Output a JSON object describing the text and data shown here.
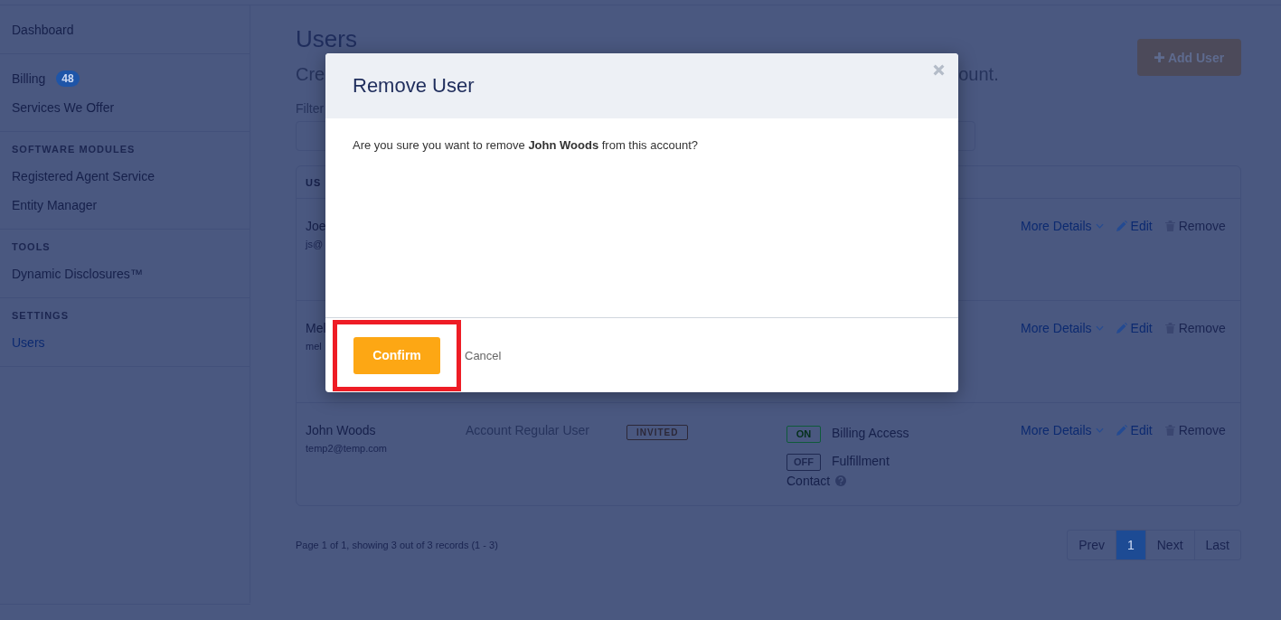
{
  "sidebar": {
    "sections": [
      {
        "items": [
          {
            "label": "Dashboard",
            "selected": false
          }
        ]
      },
      {
        "items": [
          {
            "label": "Billing",
            "badge": "48",
            "selected": false
          },
          {
            "label": "Services We Offer",
            "selected": false
          }
        ]
      },
      {
        "heading": "SOFTWARE MODULES",
        "items": [
          {
            "label": "Registered Agent Service",
            "selected": false
          },
          {
            "label": "Entity Manager",
            "selected": false
          }
        ]
      },
      {
        "heading": "TOOLS",
        "items": [
          {
            "label": "Dynamic Disclosures™",
            "selected": false
          }
        ]
      },
      {
        "heading": "SETTINGS",
        "items": [
          {
            "label": "Users",
            "selected": true
          }
        ]
      }
    ]
  },
  "page": {
    "title": "Users",
    "subtitle_left": "Cre",
    "subtitle_right": "ount.",
    "filter_label": "Filter",
    "add_button": "Add User"
  },
  "table": {
    "header": "US",
    "rows": [
      {
        "name": "Joe",
        "email": "js@",
        "actions": [
          "More Details",
          "Edit",
          "Remove"
        ]
      },
      {
        "name": "Mel",
        "email": "mel",
        "actions": [
          "More Details",
          "Edit",
          "Remove"
        ]
      },
      {
        "name": "John Woods",
        "email": "temp2@temp.com",
        "role": "Account Regular User",
        "status": "INVITED",
        "permissions": [
          {
            "toggle": "ON",
            "on": true,
            "label": "Billing Access",
            "help": false
          },
          {
            "toggle": "OFF",
            "on": false,
            "label": "Fulfillment Contact",
            "help": true
          }
        ],
        "actions": [
          "More Details",
          "Edit",
          "Remove"
        ]
      }
    ]
  },
  "footer": {
    "summary": "Page 1 of 1, showing 3 out of 3 records (1 - 3)",
    "pages": [
      {
        "label": "Prev",
        "selected": false
      },
      {
        "label": "1",
        "selected": true
      },
      {
        "label": "Next",
        "selected": false
      },
      {
        "label": "Last",
        "selected": false
      }
    ]
  },
  "modal": {
    "title": "Remove User",
    "message": "Are you sure you want to remove **John Woods** from this account?",
    "confirm": "Confirm",
    "cancel": "Cancel"
  }
}
